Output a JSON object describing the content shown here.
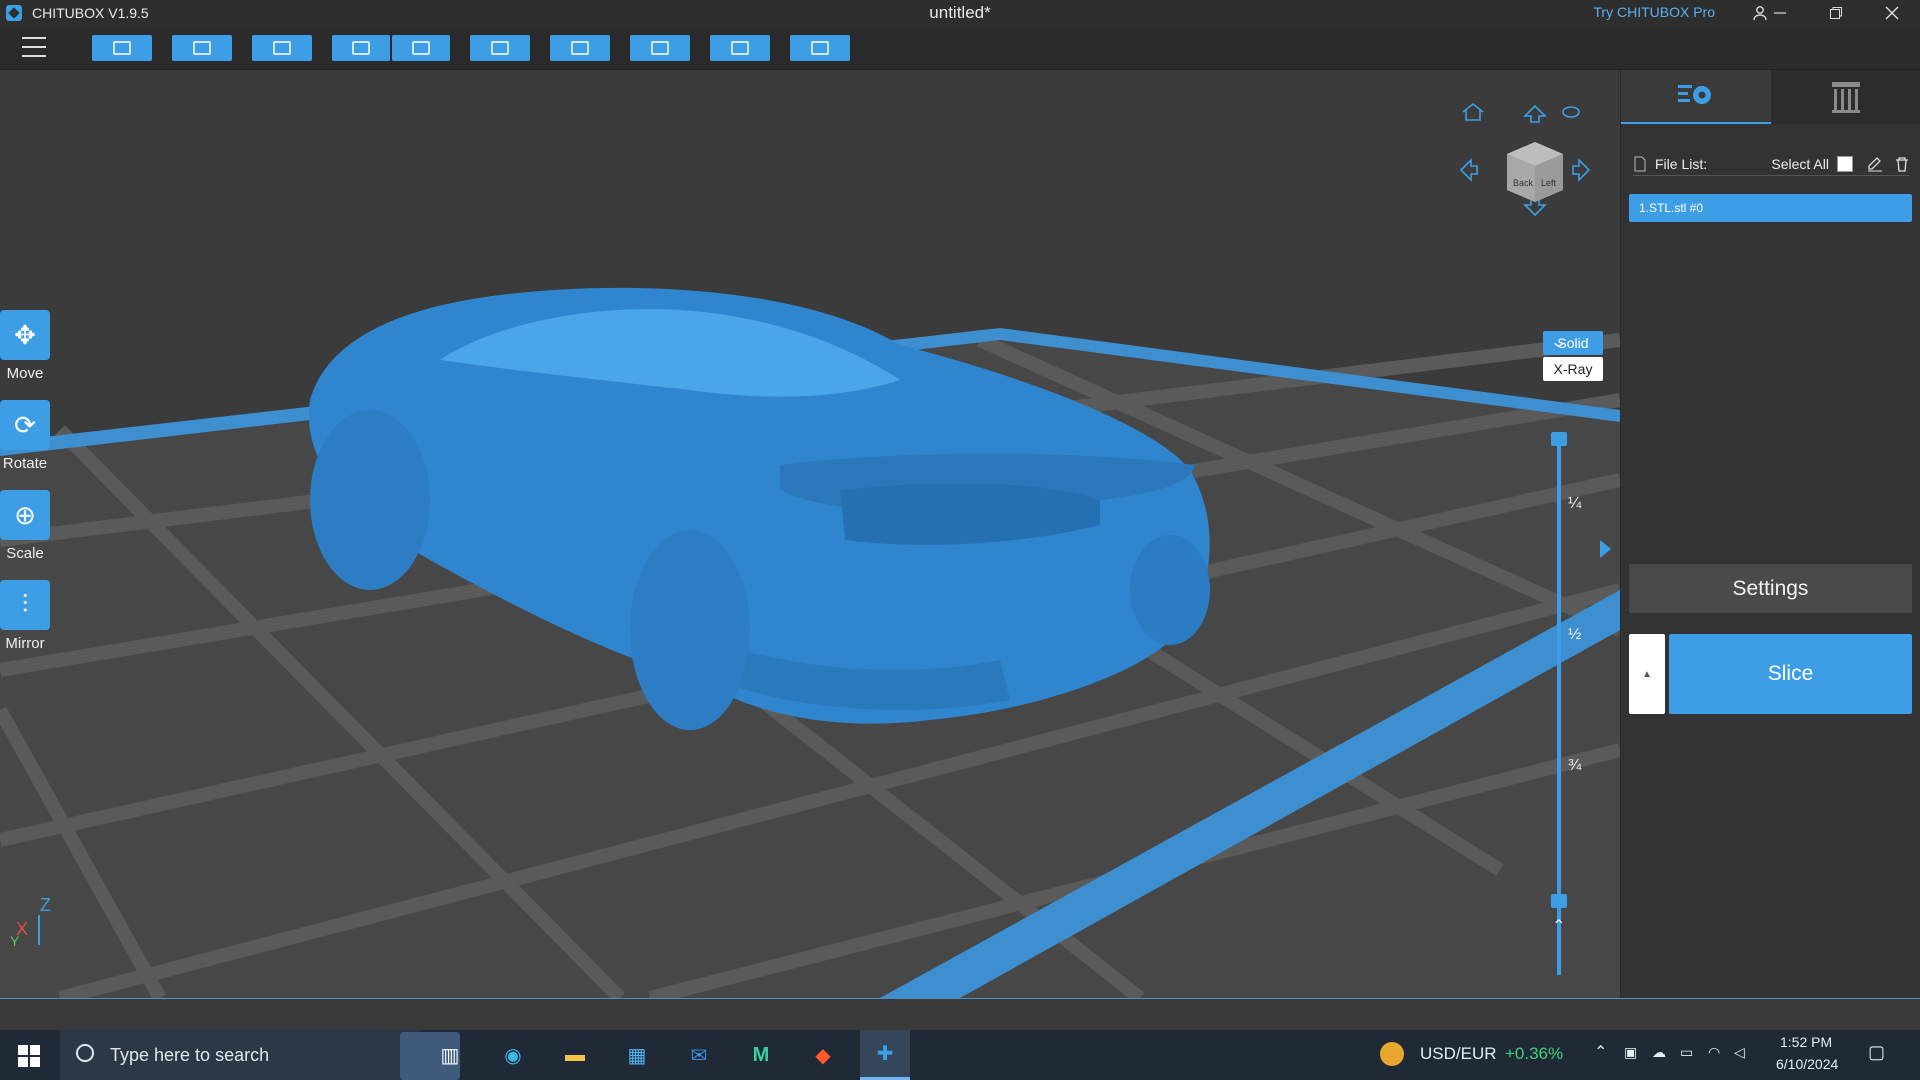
{
  "window": {
    "app_name": "CHITUBOX V1.9.5",
    "doc_title": "untitled*",
    "try_pro": "Try CHITUBOX Pro"
  },
  "colors": {
    "accent": "#3d9ee6",
    "viewport_bg": "#3b3b3b",
    "panel_bg": "#333333"
  },
  "toolbar": {
    "buttons": [
      "open-file-icon",
      "save-icon",
      "center-icon",
      "undo-icon",
      "redo-icon",
      "layout-icon",
      "hollow-icon",
      "support-icon",
      "platform-icon",
      "export-icon"
    ]
  },
  "side_tools": [
    {
      "name": "move",
      "label": "Move",
      "icon": "✥"
    },
    {
      "name": "rotate",
      "label": "Rotate",
      "icon": "⟳"
    },
    {
      "name": "scale",
      "label": "Scale",
      "icon": "⊕"
    },
    {
      "name": "mirror",
      "label": "Mirror",
      "icon": "⫶"
    }
  ],
  "view_modes": {
    "solid": "Solid",
    "xray": "X-Ray"
  },
  "view_cube": {
    "face_back": "Back",
    "face_left": "Left"
  },
  "layer_slider": {
    "quarter": "¼",
    "half": "½",
    "three_quarter": "¾"
  },
  "axes": {
    "z": "Z",
    "x": "X",
    "y": "Y"
  },
  "right_panel": {
    "file_list_label": "File List:",
    "select_all_label": "Select All",
    "files": [
      "1.STL.stl #0"
    ],
    "settings_label": "Settings",
    "slice_label": "Slice"
  },
  "taskbar": {
    "search_placeholder": "Type here to search",
    "ticker_name": "USD/EUR",
    "ticker_change": "+0.36%",
    "time": "1:52 PM",
    "date": "6/10/2024"
  }
}
